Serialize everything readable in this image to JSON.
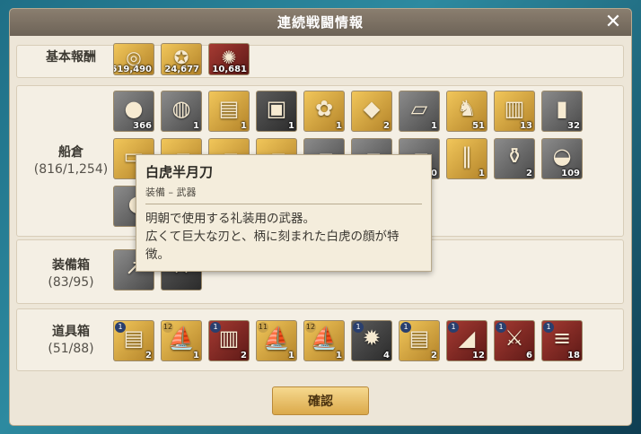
{
  "window": {
    "title": "連続戦闘情報",
    "close_icon": "close-icon"
  },
  "sections": {
    "basic": {
      "label": "基本報酬",
      "items": [
        {
          "icon": "coin-icon",
          "glyph": "◎",
          "style": "gold",
          "count": "519,490"
        },
        {
          "icon": "medal-icon",
          "glyph": "✪",
          "style": "gold",
          "count": "24,677"
        },
        {
          "icon": "gem-icon",
          "glyph": "✺",
          "style": "red",
          "count": "10,681"
        }
      ]
    },
    "hold": {
      "label": "船倉",
      "capacity": "(816/1,254)",
      "items": [
        {
          "icon": "stones-icon",
          "glyph": "●",
          "style": "gray",
          "count": "366"
        },
        {
          "icon": "bowl-icon",
          "glyph": "◍",
          "style": "gray",
          "count": "1"
        },
        {
          "icon": "scroll-icon",
          "glyph": "▤",
          "style": "gold",
          "count": "1"
        },
        {
          "icon": "lacquer-box-icon",
          "glyph": "▣",
          "style": "dark",
          "count": "1"
        },
        {
          "icon": "spices-icon",
          "glyph": "✿",
          "style": "gold",
          "count": "1"
        },
        {
          "icon": "amethyst-icon",
          "glyph": "◆",
          "style": "gold",
          "count": "2"
        },
        {
          "icon": "cloth-icon",
          "glyph": "▱",
          "style": "gray",
          "count": "1"
        },
        {
          "icon": "donkey-icon",
          "glyph": "♞",
          "style": "gold",
          "count": "51"
        },
        {
          "icon": "chest-icon",
          "glyph": "▥",
          "style": "gold",
          "count": "13"
        },
        {
          "icon": "bottle-icon",
          "glyph": "▮",
          "style": "gray",
          "count": "32"
        },
        {
          "icon": "ingot-icon",
          "glyph": "▭",
          "style": "gold",
          "count": ""
        },
        {
          "icon": "item-icon",
          "glyph": "▰",
          "style": "gold",
          "count": ""
        },
        {
          "icon": "item-icon",
          "glyph": "▰",
          "style": "gold",
          "count": ""
        },
        {
          "icon": "item-icon",
          "glyph": "▰",
          "style": "gold",
          "count": ""
        },
        {
          "icon": "item-icon",
          "glyph": "▰",
          "style": "gray",
          "count": ""
        },
        {
          "icon": "item-icon",
          "glyph": "▰",
          "style": "gray",
          "count": ""
        },
        {
          "icon": "item-icon",
          "glyph": "▰",
          "style": "gray",
          "count": "0"
        },
        {
          "icon": "bamboo-icon",
          "glyph": "‖",
          "style": "gold",
          "count": "1"
        },
        {
          "icon": "jar-icon",
          "glyph": "⚱",
          "style": "gray",
          "count": "2"
        },
        {
          "icon": "basket-icon",
          "glyph": "◒",
          "style": "gray",
          "count": "109"
        },
        {
          "icon": "bread-icon",
          "glyph": "◖",
          "style": "gray",
          "count": ""
        }
      ]
    },
    "equipment": {
      "label": "装備箱",
      "capacity": "(83/95)",
      "items": [
        {
          "icon": "spear-icon",
          "glyph": "↗",
          "style": "gray",
          "count": ""
        },
        {
          "icon": "crossed-swords-icon",
          "glyph": "✕",
          "style": "dark",
          "count": ""
        }
      ]
    },
    "tools": {
      "label": "道具箱",
      "capacity": "(51/88)",
      "items": [
        {
          "icon": "map-scroll-icon",
          "glyph": "▤",
          "style": "gold",
          "count": "2",
          "badge": "1"
        },
        {
          "icon": "ship-blueprint-icon",
          "glyph": "⛵",
          "style": "gold",
          "count": "1",
          "badge": "12",
          "badge_style": "gold"
        },
        {
          "icon": "book-icon",
          "glyph": "▥",
          "style": "red",
          "count": "2",
          "badge": "1"
        },
        {
          "icon": "ship-blueprint-icon",
          "glyph": "⛵",
          "style": "gold",
          "count": "1",
          "badge": "11",
          "badge_style": "gold"
        },
        {
          "icon": "ship-blueprint-icon",
          "glyph": "⛵",
          "style": "gold",
          "count": "1",
          "badge": "12",
          "badge_style": "gold"
        },
        {
          "icon": "compass-icon",
          "glyph": "✹",
          "style": "dark",
          "count": "4",
          "badge": "1"
        },
        {
          "icon": "map-scroll-icon",
          "glyph": "▤",
          "style": "gold",
          "count": "2",
          "badge": "1"
        },
        {
          "icon": "rolled-scroll-icon",
          "glyph": "◢",
          "style": "red",
          "count": "12",
          "badge": "1"
        },
        {
          "icon": "sword-scroll-icon",
          "glyph": "⚔",
          "style": "red",
          "count": "6",
          "badge": "1"
        },
        {
          "icon": "red-scrolls-icon",
          "glyph": "≡",
          "style": "red",
          "count": "18",
          "badge": "1"
        }
      ]
    }
  },
  "tooltip": {
    "title": "白虎半月刀",
    "category": "装備 – 武器",
    "line1": "明朝で使用する礼装用の武器。",
    "line2": "広くて巨大な刃と、柄に刻まれた白虎の顔が特",
    "line3": "徴。"
  },
  "confirm_label": "確認"
}
